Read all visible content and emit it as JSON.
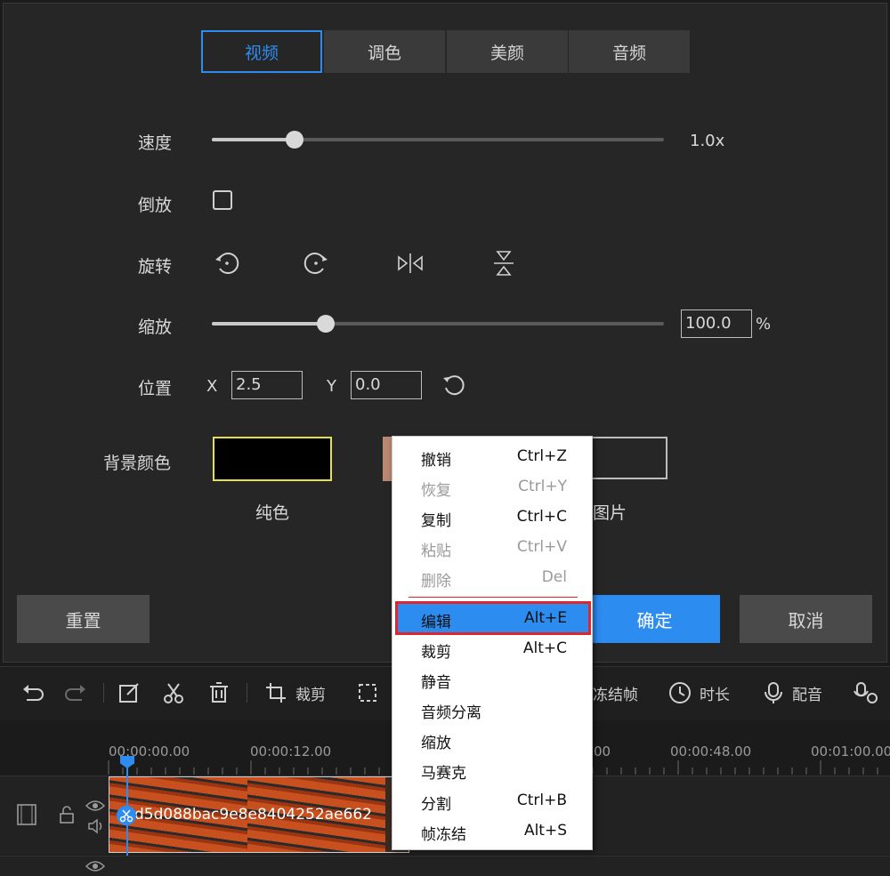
{
  "tabs": [
    {
      "label": "视频"
    },
    {
      "label": "调色"
    },
    {
      "label": "美颜"
    },
    {
      "label": "音频"
    }
  ],
  "speed": {
    "label": "速度",
    "value": "1.0x",
    "level": 0.18
  },
  "reverse": {
    "label": "倒放",
    "checked": false
  },
  "rotate": {
    "label": "旋转",
    "icons": [
      "rotate-left-icon",
      "rotate-right-icon",
      "flip-horizontal-icon",
      "flip-vertical-icon"
    ]
  },
  "zoom": {
    "label": "缩放",
    "value": "100.0",
    "unit": "%",
    "level": 0.25
  },
  "position": {
    "label": "位置",
    "x_label": "X",
    "x_value": "2.5",
    "y_label": "Y",
    "y_value": "0.0"
  },
  "background": {
    "label": "背景颜色",
    "solid_label": "纯色",
    "image_label": "图片",
    "solid_color": "#000000",
    "selected_border": "#e8e04a"
  },
  "buttons": {
    "reset": "重置",
    "confirm": "确定",
    "cancel": "取消"
  },
  "toolbar": {
    "crop": "裁剪",
    "freeze": "冻结帧",
    "duration": "时长",
    "dub": "配音"
  },
  "ruler": {
    "ticks": [
      "00:00:00.00",
      "00:00:12.00",
      "00",
      "00:00:48.00",
      "00:01:00.00"
    ]
  },
  "clip": {
    "name": "d5d088bac9e8e8404252ae662"
  },
  "context_menu": {
    "items": [
      {
        "label": "撤销",
        "shortcut": "Ctrl+Z",
        "enabled": true
      },
      {
        "label": "恢复",
        "shortcut": "Ctrl+Y",
        "enabled": false
      },
      {
        "label": "复制",
        "shortcut": "Ctrl+C",
        "enabled": true
      },
      {
        "label": "粘贴",
        "shortcut": "Ctrl+V",
        "enabled": false
      },
      {
        "label": "删除",
        "shortcut": "Del",
        "enabled": false
      },
      {
        "label": "编辑",
        "shortcut": "Alt+E",
        "enabled": true,
        "selected": true
      },
      {
        "label": "裁剪",
        "shortcut": "Alt+C",
        "enabled": true
      },
      {
        "label": "静音",
        "shortcut": "",
        "enabled": true
      },
      {
        "label": "音频分离",
        "shortcut": "",
        "enabled": true
      },
      {
        "label": "缩放",
        "shortcut": "",
        "enabled": true
      },
      {
        "label": "马赛克",
        "shortcut": "",
        "enabled": true
      },
      {
        "label": "分割",
        "shortcut": "Ctrl+B",
        "enabled": true
      },
      {
        "label": "帧冻结",
        "shortcut": "Alt+S",
        "enabled": true
      }
    ]
  },
  "colors": {
    "accent": "#2d8cf0",
    "highlight_outline": "#e0262b",
    "panel_bg": "#262626"
  }
}
